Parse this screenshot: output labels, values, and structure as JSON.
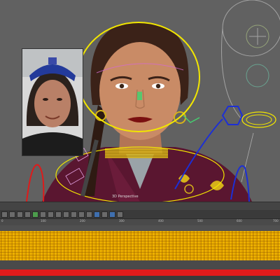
{
  "viewport": {
    "label": "3D Perspective",
    "colors": {
      "background": "#616161",
      "head_ring": "#f2e600",
      "control_blue": "#1c2fd6",
      "control_red": "#e01a1a",
      "skin": "#c98b66",
      "hair": "#3b2218",
      "robe": "#5a1630",
      "collar_gold": "#d6b21a",
      "face_ui": "#b8c7bd"
    },
    "reference_photo": {
      "icon": "face-reference-photo"
    }
  },
  "timeline": {
    "ruler_labels": [
      "0",
      "100",
      "200",
      "300",
      "400",
      "500",
      "600",
      "700"
    ],
    "keyframe_color": "#e0a100",
    "playhead_bar_color": "#e11b1b"
  },
  "toolbar": {
    "buttons": [
      {
        "icon": "select-icon"
      },
      {
        "icon": "move-icon"
      },
      {
        "icon": "rotate-icon"
      },
      {
        "icon": "scale-icon"
      },
      {
        "icon": "key-icon"
      },
      {
        "icon": "key-icon"
      },
      {
        "icon": "curve-icon"
      },
      {
        "icon": "curve-icon"
      },
      {
        "icon": "play-icon"
      },
      {
        "icon": "loop-icon"
      },
      {
        "icon": "frame-icon"
      },
      {
        "icon": "frame-icon"
      },
      {
        "icon": "graph-icon"
      },
      {
        "icon": "graph-icon"
      },
      {
        "icon": "snap-icon"
      },
      {
        "icon": "snap-icon"
      }
    ]
  }
}
